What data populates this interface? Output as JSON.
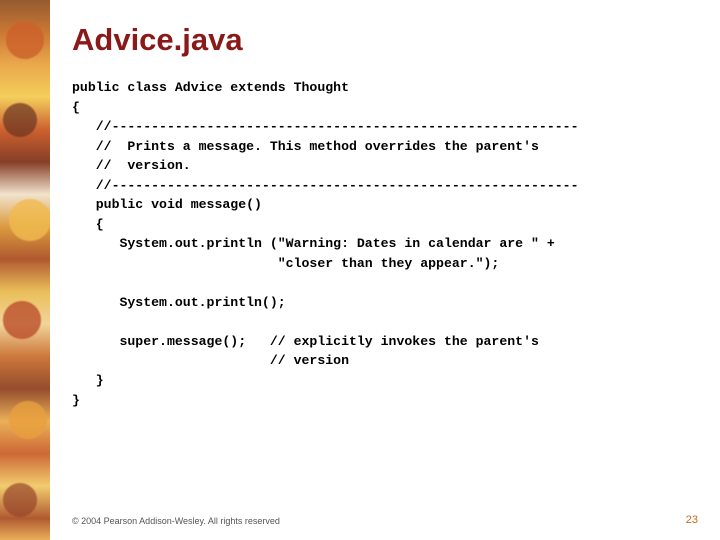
{
  "title": "Advice.java",
  "code": {
    "l01": "public class Advice extends Thought",
    "l02": "{",
    "l03": "   //-----------------------------------------------------------",
    "l04": "   //  Prints a message. This method overrides the parent's",
    "l05": "   //  version.",
    "l06": "   //-----------------------------------------------------------",
    "l07": "   public void message()",
    "l08": "   {",
    "l09": "      System.out.println (\"Warning: Dates in calendar are \" +",
    "l10": "                          \"closer than they appear.\");",
    "l11": "",
    "l12": "      System.out.println();",
    "l13": "",
    "l14": "      super.message();   // explicitly invokes the parent's",
    "l15": "                         // version",
    "l16": "   }",
    "l17": "}"
  },
  "footer": "© 2004 Pearson Addison-Wesley. All rights reserved",
  "page": "23"
}
